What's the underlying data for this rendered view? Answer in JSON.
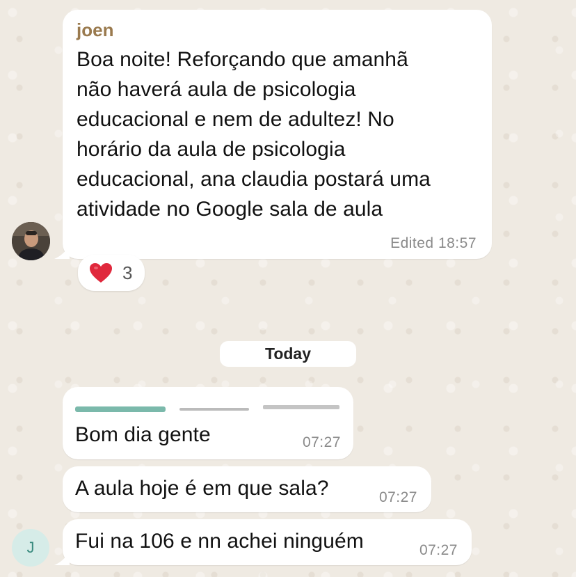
{
  "messages": [
    {
      "sender": "joen",
      "lines": [
        "Boa noite! Reforçando que amanhã",
        "não haverá aula de psicologia",
        "educacional e nem de adultez! No",
        "horário da aula de psicologia",
        "educacional, ana claudia postará uma",
        "atividade no Google sala de aula"
      ],
      "time": "Edited 18:57",
      "reaction": {
        "emoji": "heart-emoji",
        "count": "3"
      }
    },
    {
      "text": "Bom dia gente",
      "time": "07:27"
    },
    {
      "text": "A aula hoje é em que sala?",
      "time": "07:27"
    },
    {
      "text": "Fui na 106 e nn achei ninguém",
      "time": "07:27"
    }
  ],
  "date_separator": "Today",
  "avatar_initial": "J",
  "colors": {
    "sender_name": "#9a7a4e",
    "bubble": "#ffffff",
    "background": "#efeae2",
    "avatar_j_bg": "#d6ece8",
    "avatar_j_fg": "#3a8b7f",
    "heart": "#e0283c"
  }
}
